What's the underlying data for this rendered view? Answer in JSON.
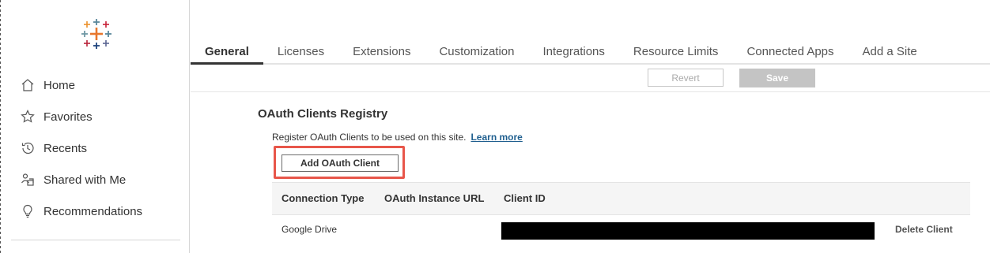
{
  "sidebar": {
    "logo_name": "tableau-logo",
    "items": [
      {
        "label": "Home",
        "icon": "home-icon"
      },
      {
        "label": "Favorites",
        "icon": "star-icon"
      },
      {
        "label": "Recents",
        "icon": "recents-icon"
      },
      {
        "label": "Shared with Me",
        "icon": "shared-icon"
      },
      {
        "label": "Recommendations",
        "icon": "lightbulb-icon"
      }
    ]
  },
  "tabs": [
    {
      "label": "General",
      "active": true
    },
    {
      "label": "Licenses"
    },
    {
      "label": "Extensions"
    },
    {
      "label": "Customization"
    },
    {
      "label": "Integrations"
    },
    {
      "label": "Resource Limits"
    },
    {
      "label": "Connected Apps"
    },
    {
      "label": "Add a Site"
    }
  ],
  "toolbar": {
    "revert_label": "Revert",
    "save_label": "Save"
  },
  "oauth": {
    "title": "OAuth Clients Registry",
    "description": "Register OAuth Clients to be used on this site.",
    "learn_more": "Learn more",
    "add_button": "Add OAuth Client",
    "columns": [
      "Connection Type",
      "OAuth Instance URL",
      "Client ID"
    ],
    "rows": [
      {
        "connection_type": "Google Drive",
        "oauth_instance_url": "",
        "client_id": "[redacted]",
        "action": "Delete Client"
      }
    ]
  },
  "colors": {
    "highlight": "#e8564a",
    "link": "#1f5f8f",
    "save_disabled": "#c4c4c4"
  }
}
